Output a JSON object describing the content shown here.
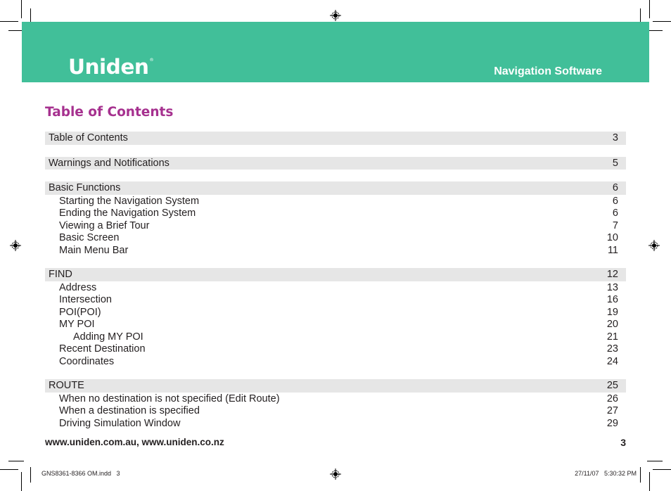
{
  "header": {
    "brand": "Uniden",
    "brand_mark": "®",
    "title": "Navigation Software",
    "color": "#41bf99"
  },
  "page_title": "Table of Contents",
  "title_color": "#a6318f",
  "toc": [
    {
      "type": "section",
      "label": "Table of Contents",
      "page": "3"
    },
    {
      "type": "gap"
    },
    {
      "type": "section",
      "label": "Warnings and Notifications",
      "page": "5"
    },
    {
      "type": "gap"
    },
    {
      "type": "section",
      "label": "Basic Functions",
      "page": "6"
    },
    {
      "type": "sub",
      "label": "Starting the Navigation System",
      "page": "6"
    },
    {
      "type": "sub",
      "label": "Ending the Navigation System",
      "page": "6"
    },
    {
      "type": "sub",
      "label": "Viewing a Brief Tour",
      "page": "7"
    },
    {
      "type": "sub",
      "label": "Basic Screen",
      "page": "10"
    },
    {
      "type": "sub",
      "label": "Main Menu Bar",
      "page": "11"
    },
    {
      "type": "gap"
    },
    {
      "type": "section",
      "label": "FIND",
      "page": "12"
    },
    {
      "type": "sub",
      "label": "Address",
      "page": "13"
    },
    {
      "type": "sub",
      "label": "Intersection",
      "page": "16"
    },
    {
      "type": "sub",
      "label": "POI(POI)",
      "page": "19"
    },
    {
      "type": "sub",
      "label": "MY POI",
      "page": "20"
    },
    {
      "type": "sub2",
      "label": "Adding MY POI",
      "page": "21"
    },
    {
      "type": "sub",
      "label": "Recent Destination",
      "page": "23"
    },
    {
      "type": "sub",
      "label": "Coordinates",
      "page": "24"
    },
    {
      "type": "gap"
    },
    {
      "type": "section",
      "label": "ROUTE",
      "page": "25"
    },
    {
      "type": "sub",
      "label": "When no destination is not specified (Edit Route)",
      "page": "26"
    },
    {
      "type": "sub",
      "label": "When a destination is specified",
      "page": "27"
    },
    {
      "type": "sub",
      "label": "Driving Simulation Window",
      "page": "29"
    }
  ],
  "footer": {
    "url": "www.uniden.com.au, www.uniden.co.nz",
    "page_number": "3"
  },
  "slug": {
    "file": "GNS8361-8366 OM.indd   3",
    "timestamp": "27/11/07   5:30:32 PM"
  }
}
